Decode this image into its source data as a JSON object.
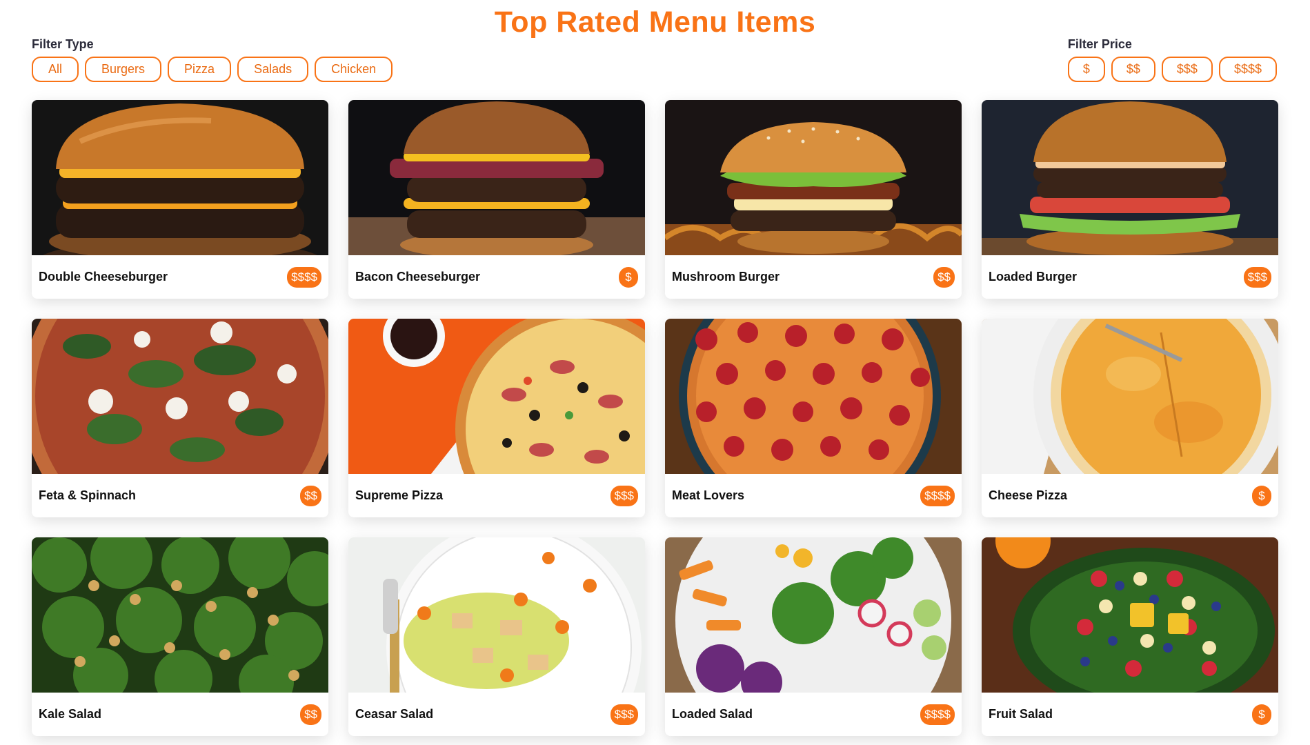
{
  "header": {
    "title": "Top Rated Menu Items"
  },
  "filters": {
    "type_label": "Filter Type",
    "types": [
      "All",
      "Burgers",
      "Pizza",
      "Salads",
      "Chicken"
    ],
    "price_label": "Filter Price",
    "prices": [
      "$",
      "$$",
      "$$$",
      "$$$$"
    ]
  },
  "items": [
    {
      "name": "Double Cheeseburger",
      "price": "$$$$",
      "image": "burger-photo"
    },
    {
      "name": "Bacon Cheeseburger",
      "price": "$",
      "image": "burger-photo"
    },
    {
      "name": "Mushroom Burger",
      "price": "$$",
      "image": "burger-photo"
    },
    {
      "name": "Loaded Burger",
      "price": "$$$",
      "image": "burger-photo"
    },
    {
      "name": "Feta & Spinnach",
      "price": "$$",
      "image": "pizza-photo"
    },
    {
      "name": "Supreme Pizza",
      "price": "$$$",
      "image": "pizza-photo"
    },
    {
      "name": "Meat Lovers",
      "price": "$$$$",
      "image": "pizza-photo"
    },
    {
      "name": "Cheese Pizza",
      "price": "$",
      "image": "pizza-photo"
    },
    {
      "name": "Kale Salad",
      "price": "$$",
      "image": "salad-photo"
    },
    {
      "name": "Ceasar Salad",
      "price": "$$$",
      "image": "salad-photo"
    },
    {
      "name": "Loaded Salad",
      "price": "$$$$",
      "image": "salad-photo"
    },
    {
      "name": "Fruit Salad",
      "price": "$",
      "image": "salad-photo"
    }
  ],
  "colors": {
    "accent": "#f97316",
    "heading": "#2b2b3a"
  }
}
